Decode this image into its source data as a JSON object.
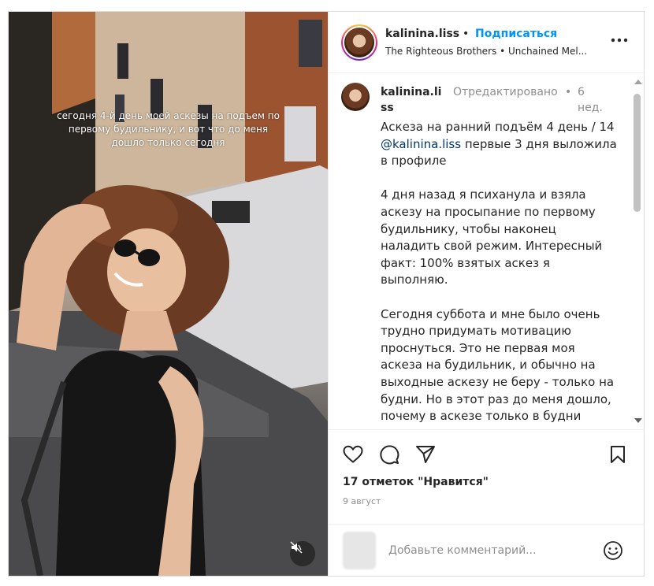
{
  "post": {
    "media": {
      "overlay_text": "сегодня 4-й день моей аскезы на подъем по первому будильнику, и вот что до меня дошло только сегодня",
      "mute_icon": "speaker-muted-icon"
    },
    "header": {
      "username": "kalinina.liss",
      "separator": "•",
      "follow_label": "Подписаться",
      "music": "The Righteous Brothers • Unchained Mel...",
      "more_icon": "more-horizontal-icon"
    },
    "caption": {
      "username": "kalinina.liss",
      "edited_label": "Отредактировано",
      "separator": "•",
      "time": "6 нед.",
      "text_lead": "Аскеза на ранний подъём 4 день / 14",
      "mention": "@kalinina.liss",
      "text_after_mention": " первые 3 дня выложила в профиле",
      "paragraph_2": "4 дня назад я психанула и взяла аскезу на просыпание по первому будильнику, чтобы наконец наладить свой режим. Интересный факт: 100% взятых аскез я выполняю.",
      "paragraph_3": "Сегодня суббота и мне было очень трудно придумать мотивацию проснуться. Это не первая моя аскеза на будильник, и обычно на выходные аскезу не беру - только на будни. Но в этот раз до меня дошло, почему в аскезе только в будни смысла нет"
    },
    "actions": {
      "like_icon": "heart-icon",
      "comment_icon": "comment-icon",
      "share_icon": "send-icon",
      "save_icon": "bookmark-icon",
      "likes_text": "17 отметок \"Нравится\"",
      "date": "9 август"
    },
    "add_comment": {
      "placeholder": "Добавьте комментарий...",
      "emoji_icon": "emoji-icon"
    }
  },
  "colors": {
    "link_blue": "#0095f6",
    "mention": "#00376b",
    "secondary_text": "#8e8e8e",
    "border": "#dbdbdb"
  }
}
